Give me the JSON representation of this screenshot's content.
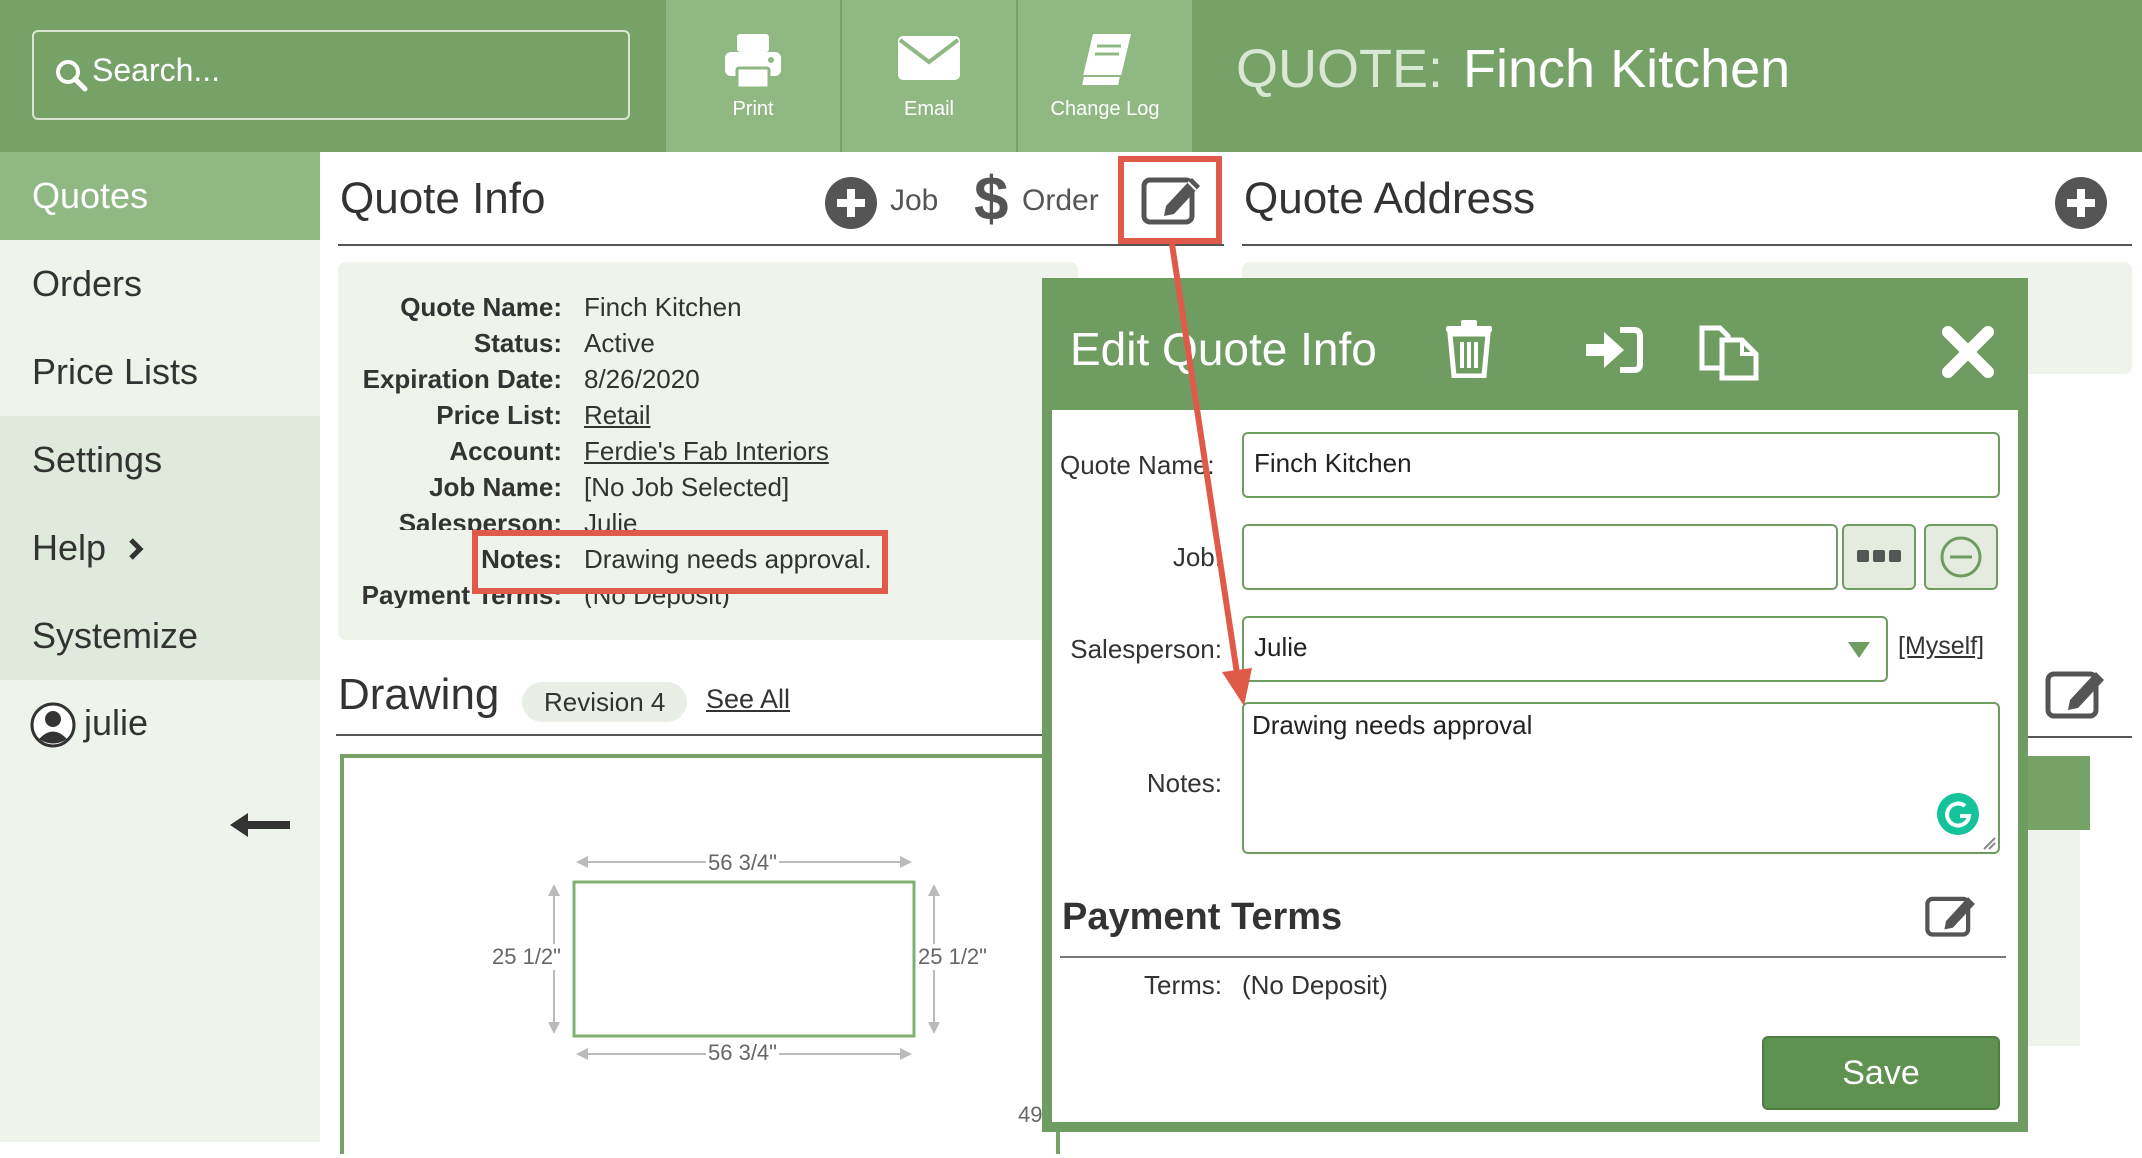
{
  "topbar": {
    "search_placeholder": "Search...",
    "buttons": [
      {
        "label": "Print",
        "icon": "printer-icon"
      },
      {
        "label": "Email",
        "icon": "envelope-icon"
      },
      {
        "label": "Change Log",
        "icon": "book-icon"
      }
    ],
    "title_prefix": "QUOTE:",
    "title": "Finch Kitchen"
  },
  "colors": {
    "primary_green": "#76a267",
    "light_green": "#8fb883",
    "panel_bg": "#eef3eb",
    "highlight_red": "#e05a4a"
  },
  "sidebar": {
    "items": [
      {
        "label": "Quotes",
        "active": true
      },
      {
        "label": "Orders"
      },
      {
        "label": "Price Lists"
      },
      {
        "label": "Settings"
      },
      {
        "label": "Help"
      },
      {
        "label": "Systemize"
      }
    ],
    "user": "julie",
    "collapse_icon": "arrow-left-icon"
  },
  "quote_info": {
    "title": "Quote Info",
    "job_label": "Job",
    "order_label": "Order",
    "fields": [
      {
        "label": "Quote Name:",
        "value": "Finch Kitchen"
      },
      {
        "label": "Status:",
        "value": "Active"
      },
      {
        "label": "Expiration Date:",
        "value": "8/26/2020"
      },
      {
        "label": "Price List:",
        "value": "Retail",
        "link": true
      },
      {
        "label": "Account:",
        "value": "Ferdie's Fab Interiors",
        "link": true
      },
      {
        "label": "Job Name:",
        "value": "[No Job Selected]"
      },
      {
        "label": "Salesperson:",
        "value": "Julie"
      },
      {
        "label": "Notes:",
        "value": "Drawing needs approval."
      },
      {
        "label": "Payment Terms:",
        "value": "(No Deposit)"
      }
    ]
  },
  "quote_address": {
    "title": "Quote Address"
  },
  "drawing": {
    "title": "Drawing",
    "revision": "Revision 4",
    "see_all": "See All",
    "dims": {
      "top": "56 3/4\"",
      "bottom": "56 3/4\"",
      "left": "25 1/2\"",
      "right": "25 1/2\""
    },
    "partial_label": "49"
  },
  "modal": {
    "title": "Edit Quote Info",
    "quote_name_label": "Quote Name:",
    "quote_name_value": "Finch Kitchen",
    "job_label": "Job:",
    "job_value": "",
    "salesperson_label": "Salesperson:",
    "salesperson_value": "Julie",
    "myself_link": "[Myself]",
    "notes_label": "Notes:",
    "notes_value": "Drawing needs approval",
    "payment_terms_title": "Payment Terms",
    "terms_label": "Terms:",
    "terms_value": "(No Deposit)",
    "save_label": "Save"
  }
}
